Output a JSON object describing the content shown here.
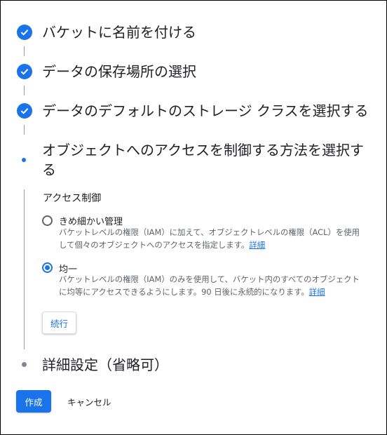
{
  "steps": [
    {
      "title": "バケットに名前を付ける",
      "state": "completed",
      "icon": "check-icon"
    },
    {
      "title": "データの保存場所の選択",
      "state": "completed",
      "icon": "check-icon"
    },
    {
      "title": "データのデフォルトのストレージ クラスを選択する",
      "state": "completed",
      "icon": "check-icon"
    },
    {
      "title_line1": "オブジェクトへのアクセスを制御する方法を選択す",
      "title_line2": "る",
      "state": "active"
    },
    {
      "title": "詳細設定（省略可）",
      "state": "pending"
    }
  ],
  "access_control": {
    "label": "アクセス制御",
    "options": [
      {
        "title": "きめ細かい管理",
        "desc_line1": "バケットレベルの権限（IAM）に加えて、オブジェクトレベルの権限（ACL）を使用",
        "desc_line2": "して個々のオブジェクトへのアクセスを指定します。",
        "link": "詳細",
        "selected": false
      },
      {
        "title": "均一",
        "desc_line1": "バケットレベルの権限（IAM）のみを使用して、バケット内のすべてのオブジェクト",
        "desc_line2": "に均等にアクセスできるようにします。90 日後に永続的になります。",
        "link": "詳細",
        "selected": true
      }
    ],
    "continue_label": "続行"
  },
  "footer": {
    "create_label": "作成",
    "cancel_label": "キャンセル"
  },
  "colors": {
    "accent": "#1a73e8",
    "text": "#202124",
    "secondary_text": "#5f6368"
  }
}
